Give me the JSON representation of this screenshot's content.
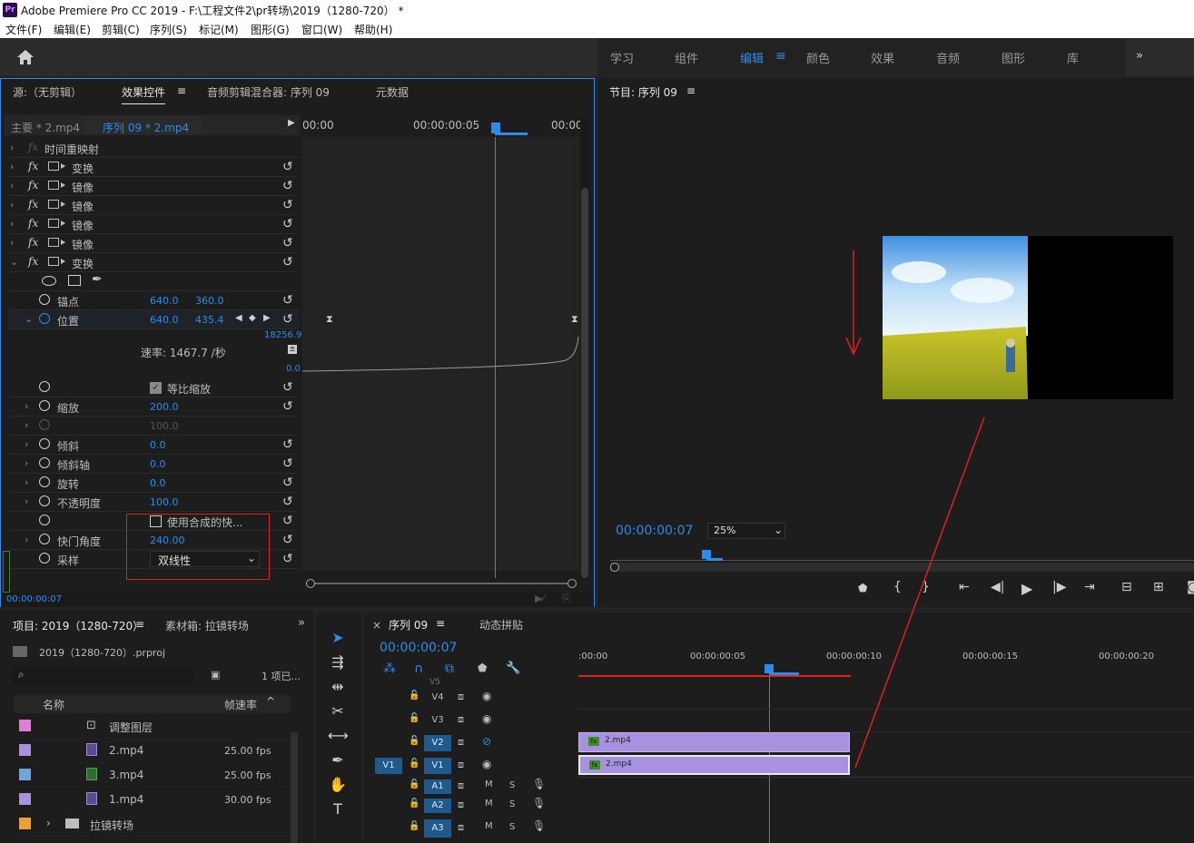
{
  "window": {
    "title": "Adobe Premiere Pro CC 2019 - F:\\工程文件2\\pr转场\\2019（1280-720） *",
    "logo": "Pr"
  },
  "menu": [
    "文件(F)",
    "编辑(E)",
    "剪辑(C)",
    "序列(S)",
    "标记(M)",
    "图形(G)",
    "窗口(W)",
    "帮助(H)"
  ],
  "workspaces": [
    "学习",
    "组件",
    "编辑",
    "颜色",
    "效果",
    "音频",
    "图形",
    "库"
  ],
  "workspace_active": "编辑",
  "workspace_more": "»",
  "top_panel": {
    "tabs": [
      "源:（无剪辑）",
      "效果控件",
      "音频剪辑混合器: 序列 09",
      "元数据"
    ],
    "tab_menu": "≡",
    "master": "主要 * 2.mp4",
    "sequence_clip": "序列 09 * 2.mp4",
    "ruler": [
      "00:00",
      "00:00:00:05",
      "00:00"
    ],
    "effects": [
      {
        "label": "时间重映射"
      },
      {
        "label": "变换"
      },
      {
        "label": "镜像"
      },
      {
        "label": "镜像"
      },
      {
        "label": "镜像"
      },
      {
        "label": "镜像"
      },
      {
        "label": "变换"
      }
    ],
    "anchor": {
      "label": "锚点",
      "x": "640.0",
      "y": "360.0"
    },
    "position": {
      "label": "位置",
      "x": "640.0",
      "y": "435.4"
    },
    "graph_max": "18256.9",
    "graph_min": "0.0",
    "speed": "速率: 1467.7 /秒",
    "uniform_scale": "等比缩放",
    "scale": {
      "label": "缩放",
      "value": "200.0"
    },
    "scale_width": "100.0",
    "skew": {
      "label": "倾斜",
      "value": "0.0"
    },
    "skew_axis": {
      "label": "倾斜轴",
      "value": "0.0"
    },
    "rotation": {
      "label": "旋转",
      "value": "0.0"
    },
    "opacity": {
      "label": "不透明度",
      "value": "100.0"
    },
    "comp_shutter": "使用合成的快...",
    "shutter_angle": {
      "label": "快门角度",
      "value": "240.00"
    },
    "sampling": {
      "label": "采样",
      "value": "双线性"
    },
    "timecode": "00:00:00:07"
  },
  "program": {
    "title": "节目: 序列 09",
    "timecode": "00:00:00:07",
    "zoom": "25%"
  },
  "project": {
    "tabs": [
      "项目: 2019（1280-720）",
      "素材箱: 拉镜转场"
    ],
    "file": "2019（1280-720）.prproj",
    "count": "1 项已...",
    "columns": [
      "名称",
      "帧速率"
    ],
    "items": [
      {
        "name": "调整图层",
        "fps": "",
        "color": "#e27ad8"
      },
      {
        "name": "2.mp4",
        "fps": "25.00 fps",
        "color": "#a892e0"
      },
      {
        "name": "3.mp4",
        "fps": "25.00 fps",
        "color": "#6fa6d9"
      },
      {
        "name": "1.mp4",
        "fps": "30.00 fps",
        "color": "#a892e0"
      },
      {
        "name": "拉镜转场",
        "fps": "",
        "color": "#f0a030"
      }
    ]
  },
  "timeline": {
    "close": "×",
    "tabs": [
      "序列 09",
      "动态拼贴"
    ],
    "timecode": "00:00:00:07",
    "ruler": [
      ":00:00",
      "00:00:00:05",
      "00:00:00:10",
      "00:00:00:15",
      "00:00:00:20"
    ],
    "tracks": [
      {
        "name": "V5"
      },
      {
        "name": "V4"
      },
      {
        "name": "V3"
      },
      {
        "name": "V2"
      },
      {
        "name": "V1"
      },
      {
        "name": "A1"
      },
      {
        "name": "A2"
      },
      {
        "name": "A3"
      }
    ],
    "source_patch": "V1",
    "clips": [
      {
        "name": "2.mp4"
      },
      {
        "name": "2.mp4"
      }
    ],
    "mute": "M",
    "solo": "S"
  },
  "annotation_color": "#e02020",
  "accent": "#2d8ceb"
}
